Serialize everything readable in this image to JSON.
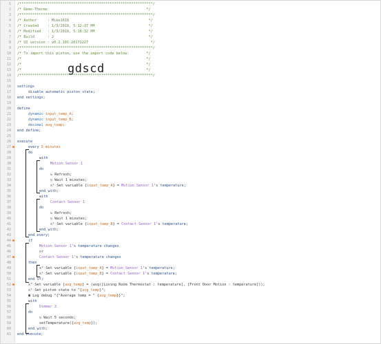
{
  "banner_text": "gdscd",
  "lines": [
    {
      "n": 1,
      "indent": 0,
      "parts": [
        [
          "c",
          "/**************************************************************/"
        ]
      ]
    },
    {
      "n": 2,
      "indent": 0,
      "parts": [
        [
          "c",
          "/* Demo-Thermo                                              */"
        ]
      ]
    },
    {
      "n": 3,
      "indent": 0,
      "parts": [
        [
          "c",
          "/**************************************************************/"
        ]
      ]
    },
    {
      "n": 4,
      "indent": 0,
      "parts": [
        [
          "c",
          "/* Author     : Mike1618                                     */"
        ]
      ]
    },
    {
      "n": 5,
      "indent": 0,
      "parts": [
        [
          "c",
          "/* Created    : 1/3/2018, 5:12:37 PM                         */"
        ]
      ]
    },
    {
      "n": 6,
      "indent": 0,
      "parts": [
        [
          "c",
          "/* Modified   : 1/3/2018, 5:18:32 PM                         */"
        ]
      ]
    },
    {
      "n": 7,
      "indent": 0,
      "parts": [
        [
          "c",
          "/* Build      : 2                                            */"
        ]
      ]
    },
    {
      "n": 8,
      "indent": 0,
      "parts": [
        [
          "c",
          "/* UI version : v0.2.101.20171227                             */"
        ]
      ]
    },
    {
      "n": 9,
      "indent": 0,
      "parts": [
        [
          "c",
          "/**************************************************************/"
        ]
      ]
    },
    {
      "n": 10,
      "indent": 0,
      "parts": [
        [
          "c",
          "/* To import this piston, use the import code below:        */"
        ]
      ]
    },
    {
      "n": 11,
      "indent": 0,
      "parts": [
        [
          "c",
          "/*                                                          */"
        ]
      ]
    },
    {
      "n": 12,
      "indent": 0,
      "parts": [
        [
          "c",
          "/*                                                          */"
        ]
      ]
    },
    {
      "n": 13,
      "indent": 0,
      "parts": [
        [
          "c",
          "/*                                                          */"
        ]
      ]
    },
    {
      "n": 14,
      "indent": 0,
      "parts": [
        [
          "c",
          "/**************************************************************/"
        ]
      ]
    },
    {
      "n": 15,
      "indent": 0,
      "parts": []
    },
    {
      "n": 16,
      "indent": 0,
      "parts": [
        [
          "k",
          "settings"
        ]
      ]
    },
    {
      "n": 17,
      "indent": 1,
      "parts": [
        [
          "k",
          "disable automatic piston state"
        ],
        [
          "s",
          ";"
        ]
      ]
    },
    {
      "n": 18,
      "indent": 0,
      "parts": [
        [
          "k",
          "end settings"
        ],
        [
          "s",
          ";"
        ]
      ]
    },
    {
      "n": 19,
      "indent": 0,
      "parts": []
    },
    {
      "n": 20,
      "indent": 0,
      "parts": [
        [
          "k",
          "define"
        ]
      ]
    },
    {
      "n": 21,
      "indent": 1,
      "parts": [
        [
          "t",
          "dynamic "
        ],
        [
          "v",
          "input_temp_A"
        ],
        [
          "s",
          ";"
        ]
      ]
    },
    {
      "n": 22,
      "indent": 1,
      "parts": [
        [
          "t",
          "dynamic "
        ],
        [
          "v",
          "input_temp_B"
        ],
        [
          "s",
          ";"
        ]
      ]
    },
    {
      "n": 23,
      "indent": 1,
      "parts": [
        [
          "t",
          "decimal "
        ],
        [
          "v",
          "avg_temp"
        ],
        [
          "s",
          ";"
        ]
      ]
    },
    {
      "n": 24,
      "indent": 0,
      "parts": [
        [
          "k",
          "end define"
        ],
        [
          "s",
          ";"
        ]
      ]
    },
    {
      "n": 25,
      "indent": 0,
      "parts": []
    },
    {
      "n": 26,
      "indent": 0,
      "parts": [
        [
          "k",
          "execute"
        ]
      ]
    },
    {
      "n": 27,
      "indent": 1,
      "parts": [
        [
          "k",
          "every "
        ],
        [
          "v",
          "5 minutes"
        ]
      ]
    },
    {
      "n": 28,
      "indent": 1,
      "parts": [
        [
          "k",
          "do"
        ]
      ]
    },
    {
      "n": 29,
      "indent": 2,
      "parts": [
        [
          "k",
          "with"
        ]
      ]
    },
    {
      "n": 30,
      "indent": 3,
      "parts": [
        [
          "d",
          "Motion Sensor 1"
        ]
      ]
    },
    {
      "n": 31,
      "indent": 2,
      "parts": [
        [
          "k",
          "do"
        ]
      ]
    },
    {
      "n": 32,
      "indent": 3,
      "parts": [
        [
          "ic",
          "↻ "
        ],
        [
          "s",
          "Refresh;"
        ]
      ]
    },
    {
      "n": 33,
      "indent": 3,
      "parts": [
        [
          "ic",
          "◷ "
        ],
        [
          "s",
          "Wait 1 minutes;"
        ]
      ]
    },
    {
      "n": 34,
      "indent": 3,
      "parts": [
        [
          "ic",
          "x² "
        ],
        [
          "s",
          "Set variable {"
        ],
        [
          "v",
          "input_temp_A"
        ],
        [
          "s",
          "} = "
        ],
        [
          "d",
          "Motion Sensor 1"
        ],
        [
          "s",
          "'s "
        ],
        [
          "k",
          "temperature"
        ],
        [
          "s",
          ";"
        ]
      ]
    },
    {
      "n": 35,
      "indent": 2,
      "parts": [
        [
          "k",
          "end with"
        ],
        [
          "s",
          ";"
        ]
      ]
    },
    {
      "n": 36,
      "indent": 2,
      "parts": [
        [
          "k",
          "with"
        ]
      ]
    },
    {
      "n": 37,
      "indent": 3,
      "parts": [
        [
          "d",
          "Contact Sensor 1"
        ]
      ]
    },
    {
      "n": 38,
      "indent": 2,
      "parts": [
        [
          "k",
          "do"
        ]
      ]
    },
    {
      "n": 39,
      "indent": 3,
      "parts": [
        [
          "ic",
          "↻ "
        ],
        [
          "s",
          "Refresh;"
        ]
      ]
    },
    {
      "n": 40,
      "indent": 3,
      "parts": [
        [
          "ic",
          "◷ "
        ],
        [
          "s",
          "Wait 1 minutes;"
        ]
      ]
    },
    {
      "n": 41,
      "indent": 3,
      "parts": [
        [
          "ic",
          "x² "
        ],
        [
          "s",
          "Set variable {"
        ],
        [
          "v",
          "input_temp_B"
        ],
        [
          "s",
          "} = "
        ],
        [
          "d",
          "Contact Sensor 1"
        ],
        [
          "s",
          "'s "
        ],
        [
          "k",
          "temperature"
        ],
        [
          "s",
          ";"
        ]
      ]
    },
    {
      "n": 42,
      "indent": 2,
      "parts": [
        [
          "k",
          "end with"
        ],
        [
          "s",
          ";"
        ]
      ]
    },
    {
      "n": 43,
      "indent": 1,
      "parts": [
        [
          "k",
          "end every"
        ],
        [
          "s",
          ";"
        ]
      ]
    },
    {
      "n": 44,
      "indent": 1,
      "parts": [
        [
          "k",
          "if"
        ]
      ]
    },
    {
      "n": 45,
      "indent": 2,
      "parts": [
        [
          "d",
          "Motion Sensor 1"
        ],
        [
          "s",
          "'s "
        ],
        [
          "k",
          "temperature changes"
        ]
      ]
    },
    {
      "n": 46,
      "indent": 2,
      "parts": [
        [
          "k",
          "or"
        ]
      ]
    },
    {
      "n": 47,
      "indent": 2,
      "parts": [
        [
          "d",
          "Contact Sensor 1"
        ],
        [
          "s",
          "'s "
        ],
        [
          "k",
          "temperature changes"
        ]
      ]
    },
    {
      "n": 48,
      "indent": 1,
      "parts": [
        [
          "k",
          "then"
        ]
      ]
    },
    {
      "n": 49,
      "indent": 2,
      "parts": [
        [
          "ic",
          "x² "
        ],
        [
          "s",
          "Set variable {"
        ],
        [
          "v",
          "input_temp_A"
        ],
        [
          "s",
          "} = "
        ],
        [
          "d",
          "Motion Sensor 1"
        ],
        [
          "s",
          "'s "
        ],
        [
          "k",
          "temperature"
        ],
        [
          "s",
          ";"
        ]
      ]
    },
    {
      "n": 50,
      "indent": 2,
      "parts": [
        [
          "ic",
          "x² "
        ],
        [
          "s",
          "Set variable {"
        ],
        [
          "v",
          "input_temp_B"
        ],
        [
          "s",
          "} = "
        ],
        [
          "d",
          "Contact Sensor 1"
        ],
        [
          "s",
          "'s "
        ],
        [
          "k",
          "temperature"
        ],
        [
          "s",
          ";"
        ]
      ]
    },
    {
      "n": 51,
      "indent": 1,
      "parts": [
        [
          "k",
          "end if"
        ],
        [
          "s",
          ";"
        ]
      ]
    },
    {
      "n": 52,
      "indent": 1,
      "parts": [
        [
          "ic",
          "x² "
        ],
        [
          "s",
          "Set variable {"
        ],
        [
          "v",
          "avg_temp"
        ],
        [
          "s",
          "} = "
        ],
        [
          "s",
          "(avg([Living Room Thermostat : temperature], [Front Door Motion : temperature]));"
        ]
      ]
    },
    {
      "n": 53,
      "indent": 1,
      "parts": [
        [
          "ic",
          "x² "
        ],
        [
          "s",
          "Set piston state to \"{"
        ],
        [
          "v",
          "avg_temp"
        ],
        [
          "s",
          "}\";"
        ]
      ]
    },
    {
      "n": 54,
      "indent": 1,
      "parts": [
        [
          "ic",
          "☗ "
        ],
        [
          "s",
          "Log debug \"{\"Average temp = \" {"
        ],
        [
          "v",
          "avg_temp"
        ],
        [
          "s",
          "}}\";"
        ]
      ]
    },
    {
      "n": 55,
      "indent": 1,
      "parts": [
        [
          "k",
          "with"
        ]
      ]
    },
    {
      "n": 56,
      "indent": 2,
      "parts": [
        [
          "d",
          "Dimmer 3"
        ]
      ]
    },
    {
      "n": 57,
      "indent": 1,
      "parts": [
        [
          "k",
          "do"
        ]
      ]
    },
    {
      "n": 58,
      "indent": 2,
      "parts": [
        [
          "ic",
          "◷ "
        ],
        [
          "s",
          "Wait 5 seconds;"
        ]
      ]
    },
    {
      "n": 59,
      "indent": 2,
      "parts": [
        [
          "s",
          "setTemperature({"
        ],
        [
          "v",
          "avg_temp"
        ],
        [
          "s",
          "});"
        ]
      ]
    },
    {
      "n": 60,
      "indent": 1,
      "parts": [
        [
          "k",
          "end with"
        ],
        [
          "s",
          ";"
        ]
      ]
    },
    {
      "n": 61,
      "indent": 0,
      "parts": [
        [
          "k",
          "end execute"
        ],
        [
          "s",
          ";"
        ]
      ]
    }
  ],
  "warning_markers": [
    27,
    44,
    47,
    52
  ]
}
